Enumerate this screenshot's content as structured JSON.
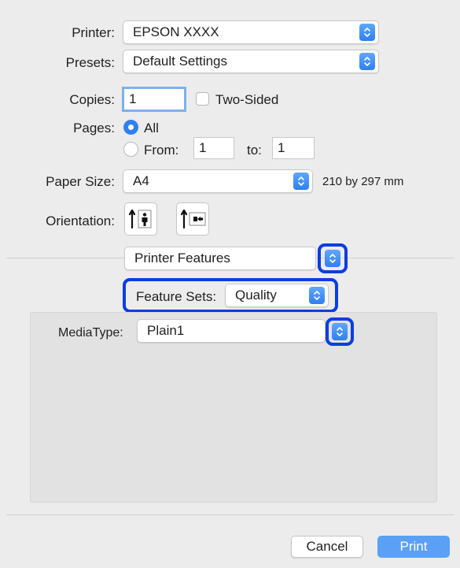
{
  "printer": {
    "label": "Printer:",
    "value": "EPSON XXXX"
  },
  "presets": {
    "label": "Presets:",
    "value": "Default Settings"
  },
  "copies": {
    "label": "Copies:",
    "value": "1",
    "two_sided_label": "Two-Sided",
    "two_sided_checked": false
  },
  "pages": {
    "label": "Pages:",
    "all_label": "All",
    "from_label": "From:",
    "from_value": "1",
    "to_label": "to:",
    "to_value": "1",
    "selected": "All"
  },
  "paper_size": {
    "label": "Paper Size:",
    "value": "A4",
    "dimensions": "210 by 297 mm"
  },
  "orientation": {
    "label": "Orientation:",
    "options": [
      "portrait-icon",
      "landscape-icon"
    ],
    "selected": "portrait"
  },
  "section": {
    "value": "Printer Features"
  },
  "feature_sets": {
    "label": "Feature Sets:",
    "value": "Quality"
  },
  "media_type": {
    "label": "MediaType:",
    "value": "Plain1"
  },
  "buttons": {
    "cancel": "Cancel",
    "print": "Print"
  },
  "colors": {
    "accent": "#2f7ff0",
    "highlight": "#0a3ee0",
    "print_button": "#5aa0f5"
  }
}
